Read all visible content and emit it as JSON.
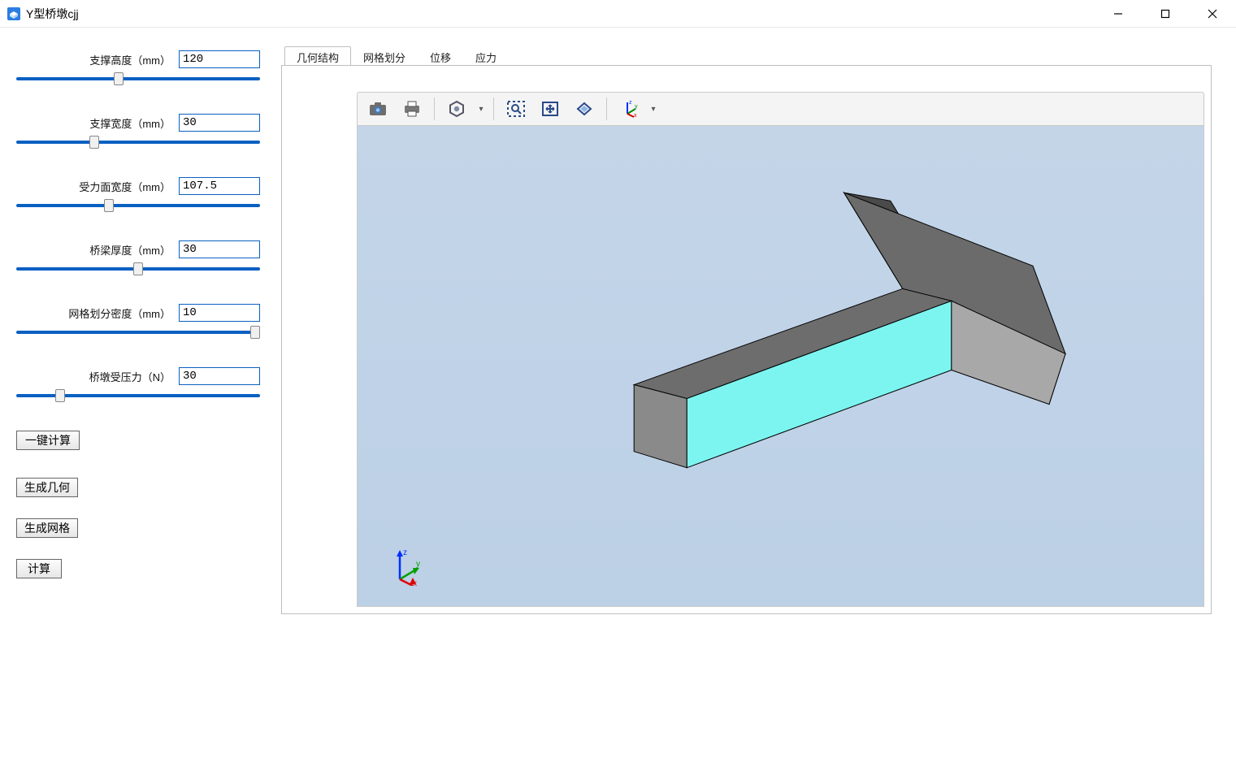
{
  "window": {
    "title": "Y型桥墩cjj"
  },
  "params": [
    {
      "label": "支撑高度（mm）",
      "value": "120",
      "pos": 42
    },
    {
      "label": "支撑宽度（mm）",
      "value": "30",
      "pos": 32
    },
    {
      "label": "受力面宽度（mm）",
      "value": "107.5",
      "pos": 38
    },
    {
      "label": "桥梁厚度（mm）",
      "value": "30",
      "pos": 50
    },
    {
      "label": "网格划分密度（mm）",
      "value": "10",
      "pos": 98
    },
    {
      "label": "桥墩受压力（N）",
      "value": "30",
      "pos": 18
    }
  ],
  "buttons": {
    "one_click": "一键计算",
    "gen_geom": "生成几何",
    "gen_mesh": "生成网格",
    "compute": "计算"
  },
  "tabs": [
    {
      "label": "几何结构",
      "active": true
    },
    {
      "label": "网格划分",
      "active": false
    },
    {
      "label": "位移",
      "active": false
    },
    {
      "label": "应力",
      "active": false
    }
  ],
  "toolbar_icons": {
    "camera": "camera-icon",
    "print": "printer-icon",
    "iso": "iso-view-icon",
    "zoom_window": "zoom-window-icon",
    "fit": "fit-view-icon",
    "rotate": "rotate-view-icon",
    "axes": "axes-toggle-icon"
  },
  "axes_labels": {
    "x": "x",
    "y": "y",
    "z": "z"
  }
}
